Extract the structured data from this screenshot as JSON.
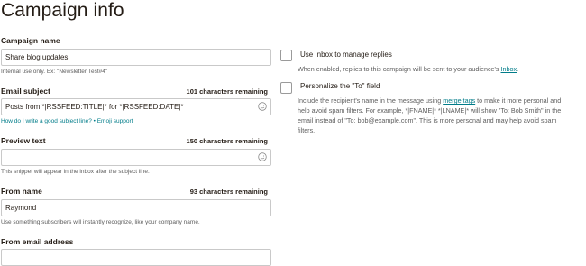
{
  "page": {
    "title": "Campaign info"
  },
  "campaign_name": {
    "label": "Campaign name",
    "value": "Share blog updates",
    "hint": "Internal use only. Ex: \"Newsletter Test#4\""
  },
  "email_subject": {
    "label": "Email subject",
    "remaining": "101 characters remaining",
    "value": "Posts from *|RSSFEED:TITLE|* for *|RSSFEED:DATE|*",
    "help_link": "How do I write a good subject line?",
    "separator": " • ",
    "emoji_link": "Emoji support"
  },
  "preview_text": {
    "label": "Preview text",
    "remaining": "150 characters remaining",
    "value": "",
    "hint": "This snippet will appear in the inbox after the subject line."
  },
  "from_name": {
    "label": "From name",
    "remaining": "93 characters remaining",
    "value": "Raymond",
    "hint": "Use something subscribers will instantly recognize, like your company name."
  },
  "from_email": {
    "label": "From email address"
  },
  "inbox_option": {
    "label": "Use Inbox to manage replies",
    "desc_before": "When enabled, replies to this campaign will be sent to your audience's ",
    "desc_link": "Inbox",
    "desc_after": "."
  },
  "personalize_option": {
    "label": "Personalize the \"To\" field",
    "desc_before": "Include the recipient's name in the message using ",
    "desc_link": "merge tags",
    "desc_after": " to make it more personal and help avoid spam filters. For example, *|FNAME|* *|LNAME|* will show \"To: Bob Smith\" in the email instead of \"To: bob@example.com\". This is more personal and may help avoid spam filters."
  }
}
